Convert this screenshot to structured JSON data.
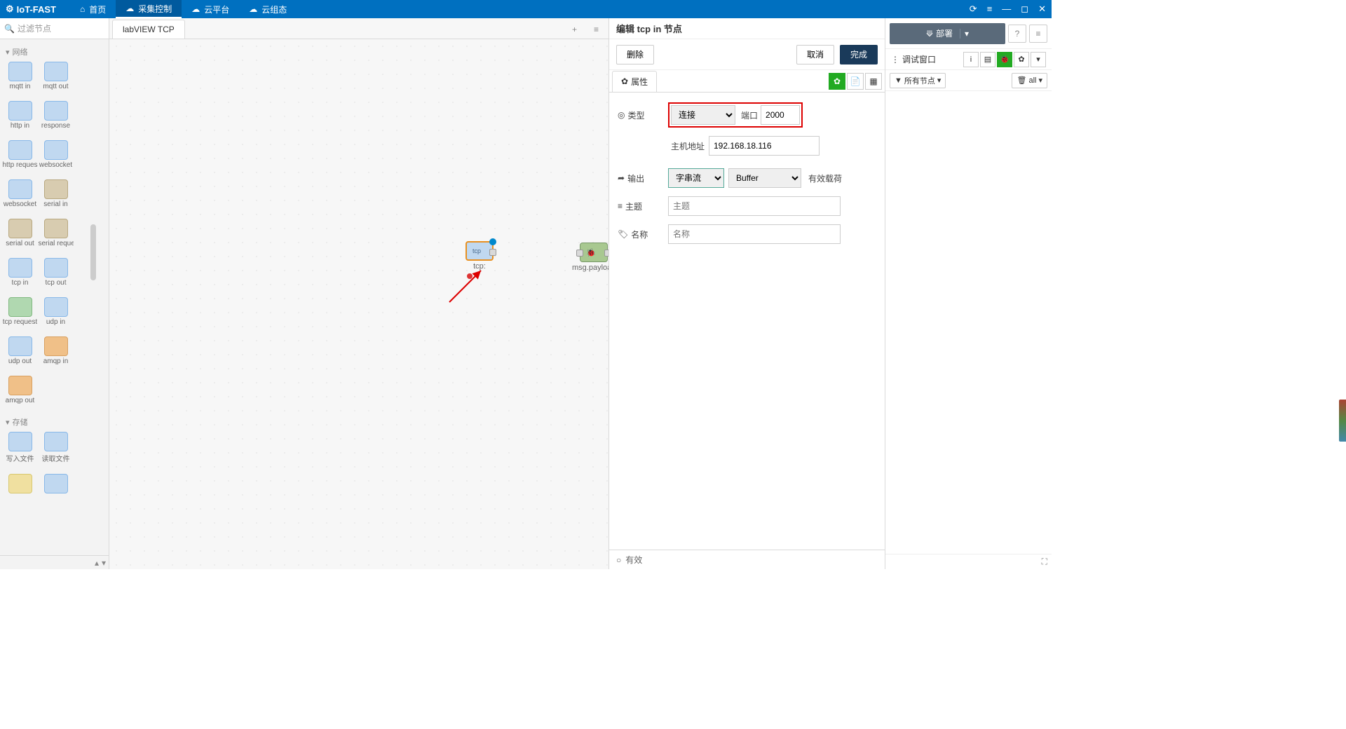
{
  "titlebar": {
    "logo": "IoT-FAST",
    "nav": [
      "首页",
      "采集控制",
      "云平台",
      "云组态"
    ],
    "active_nav": 1
  },
  "palette": {
    "search_placeholder": "过滤节点",
    "categories": [
      {
        "name": "网络",
        "nodes": [
          "mqtt in",
          "mqtt out",
          "http in",
          "response",
          "http reques",
          "websocket",
          "websocket",
          "serial in",
          "serial out",
          "serial reque",
          "tcp in",
          "tcp out",
          "tcp request",
          "udp in",
          "udp out",
          "amqp in",
          "amqp out"
        ]
      },
      {
        "name": "存储",
        "nodes": [
          "写入文件",
          "读取文件"
        ]
      }
    ]
  },
  "tabs": {
    "active": "labVIEW TCP"
  },
  "canvas": {
    "node1_label": "tcp:",
    "node2_label": "msg.payload"
  },
  "edit": {
    "title": "编辑 tcp in 节点",
    "delete_btn": "删除",
    "cancel_btn": "取消",
    "done_btn": "完成",
    "props_tab": "属性",
    "fields": {
      "type_label": "类型",
      "type_value": "连接",
      "port_label": "端口",
      "port_value": "2000",
      "host_label": "主机地址",
      "host_value": "192.168.18.116",
      "output_label": "输出",
      "output_stream": "字串流",
      "output_type": "Buffer",
      "payload_suffix": "有效载荷",
      "topic_label": "主题",
      "topic_placeholder": "主题",
      "name_label": "名称",
      "name_placeholder": "名称"
    },
    "footer": "有效"
  },
  "right": {
    "deploy": "部署",
    "debug_title": "调试窗口",
    "filter_all_nodes": "所有节点",
    "filter_all": "all"
  }
}
